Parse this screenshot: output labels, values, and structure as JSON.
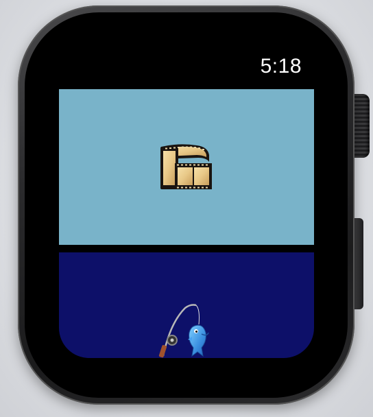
{
  "status_bar": {
    "time": "5:18"
  },
  "buttons": [
    {
      "id": "movies",
      "icon": "film-strip-icon",
      "background": "#79b3c9"
    },
    {
      "id": "fishing",
      "icon": "fishing-rod-fish-icon",
      "background": "#0d1069"
    }
  ],
  "colors": {
    "screen_background": "#000000",
    "time_text": "#ffffff"
  }
}
